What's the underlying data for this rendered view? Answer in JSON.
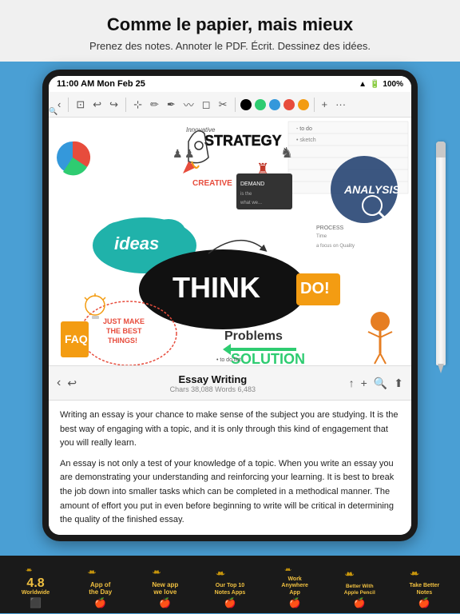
{
  "header": {
    "title": "Comme le papier, mais mieux",
    "subtitle": "Prenez des notes. Annoter le PDF. Écrit. Dessinez des idées."
  },
  "status_bar": {
    "time": "11:00 AM  Mon Feb 25",
    "battery": "100%",
    "wifi_icon": "wifi",
    "battery_icon": "battery"
  },
  "toolbar": {
    "buttons": [
      "‹",
      "↩",
      "↪",
      "⊡",
      "✏",
      "〰",
      "○",
      "✂",
      "⊕",
      "✕"
    ],
    "colors": [
      "#000000",
      "#2ecc71",
      "#3498db",
      "#e74c3c",
      "#f39c12"
    ],
    "more": "···"
  },
  "document": {
    "title": "Essay Writing",
    "meta": "Chars 38,088 Words 6,483",
    "content": "Writing an essay is your chance to make sense of the subject you are studying. It is the best way of engaging with a topic, and it is only through this kind of engagement that you will really learn.\nAn essay is not only a test of your knowledge of a topic. When you write an essay you are demonstrating your understanding and reinforcing your learning. It is best to break the job down into smaller tasks which can be completed in a methodical manner. The amount of effort you put in even before beginning to write will be critical in determining the quality of the finished essay.\nIf you read this handout carefully and try to follow the guidelines in it you will"
  },
  "badges": [
    {
      "number": "4.8",
      "line1": "Worldwide",
      "icon": "⬛",
      "sub": ""
    },
    {
      "number": "",
      "line1": "App of",
      "line2": "the Day",
      "icon": "🍎",
      "sub": ""
    },
    {
      "number": "",
      "line1": "New app",
      "line2": "we love",
      "icon": "🍎",
      "sub": ""
    },
    {
      "number": "",
      "line1": "Our Top 10",
      "line2": "Notes Apps",
      "icon": "🍎",
      "sub": ""
    },
    {
      "number": "",
      "line1": "Work Anywhere",
      "line2": "App",
      "icon": "🍎",
      "sub": ""
    },
    {
      "number": "",
      "line1": "Better With Apple",
      "line2": "Pencil",
      "icon": "🍎",
      "sub": ""
    },
    {
      "number": "",
      "line1": "Take Better",
      "line2": "Notes",
      "icon": "🍎",
      "sub": ""
    }
  ],
  "colors": {
    "background": "#4a9fd4",
    "ipad_body": "#1a1a1a",
    "badge_gold": "#f0c040"
  }
}
